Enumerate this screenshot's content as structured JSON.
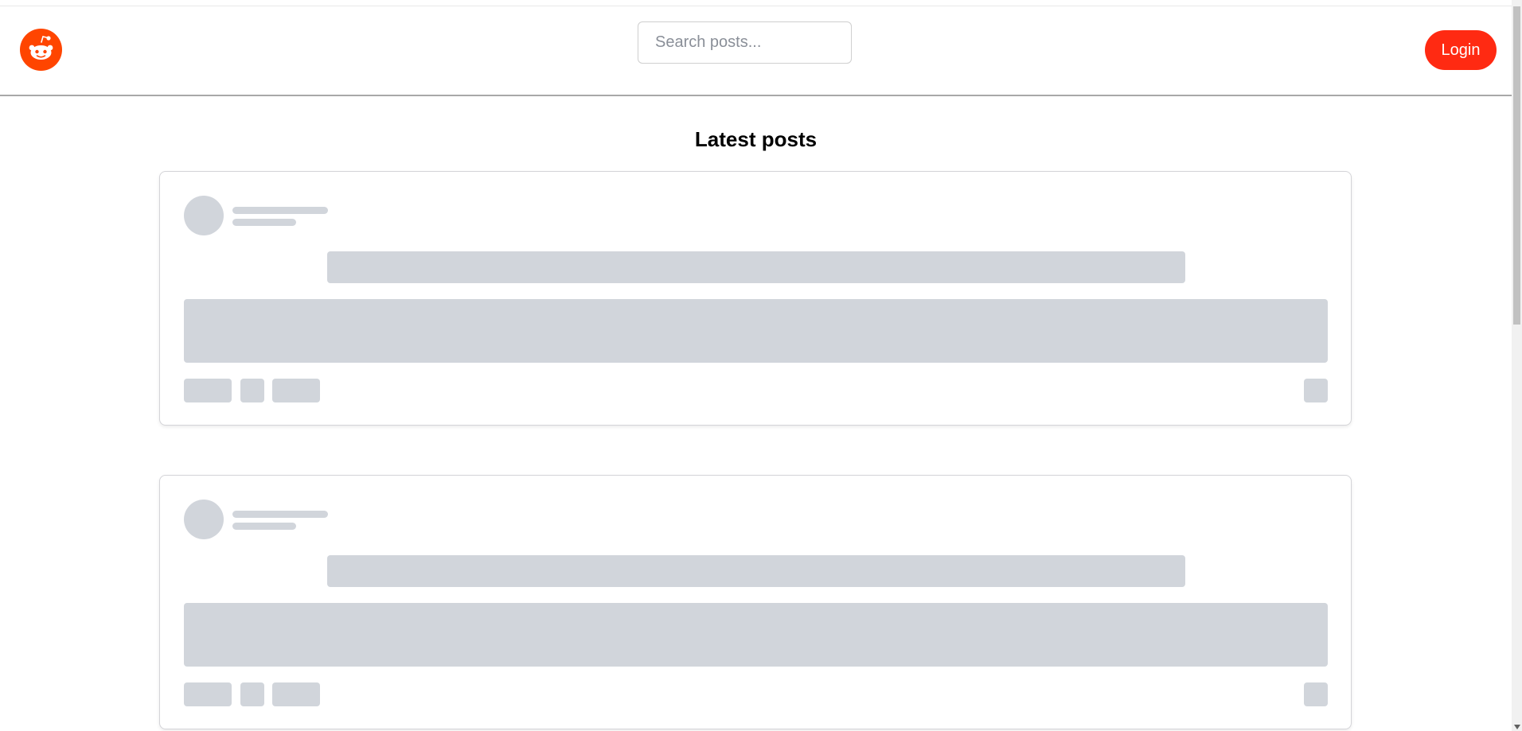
{
  "header": {
    "logo_icon": "reddit-logo-icon",
    "search": {
      "placeholder": "Search posts...",
      "value": ""
    },
    "login_label": "Login"
  },
  "main": {
    "title": "Latest posts",
    "posts_state": "loading"
  },
  "colors": {
    "brand": "#ff4500",
    "login_button": "#ff2a12",
    "skeleton": "#d1d5db"
  }
}
